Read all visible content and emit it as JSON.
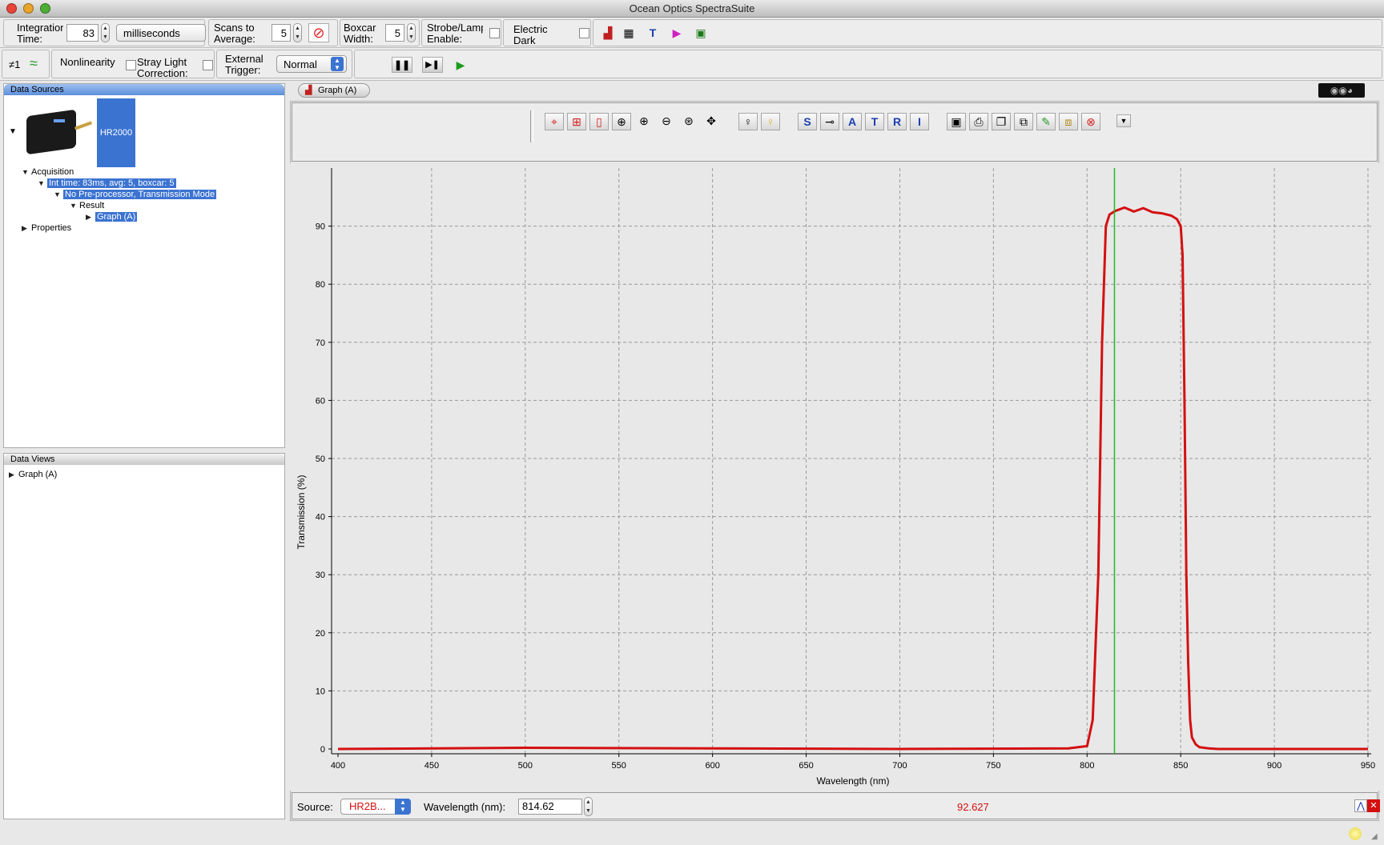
{
  "window": {
    "title": "Ocean Optics SpectraSuite"
  },
  "acq": {
    "integration_label": "Integration Time:",
    "integration_value": "83",
    "unit": "milliseconds",
    "scans_label": "Scans to Average:",
    "scans_value": "5",
    "boxcar_label": "Boxcar Width:",
    "boxcar_value": "5",
    "strobe_label": "Strobe/Lamp Enable:",
    "electric_dark_label": "Electric Dark"
  },
  "row2": {
    "nonlinearity_label": "Nonlinearity",
    "stray_light_label": "Stray Light Correction:",
    "ext_trigger_label": "External Trigger:",
    "trigger_mode": "Normal",
    "marker_label": "≠1"
  },
  "left": {
    "data_sources_title": "Data Sources",
    "device_name": "HR2000",
    "acquisition": "Acquisition",
    "params": "Int time: 83ms, avg: 5, boxcar: 5",
    "processor": "No Pre-processor, Transmission Mode",
    "result": "Result",
    "graph_node": "Graph (A)",
    "properties": "Properties",
    "data_views_title": "Data Views",
    "view_node": "Graph (A)"
  },
  "graph_tab": {
    "label": "Graph (A)"
  },
  "plot_toolbar": {
    "letters": [
      "S",
      "A",
      "T",
      "R",
      "I"
    ]
  },
  "chart_data": {
    "type": "line",
    "xlabel": "Wavelength (nm)",
    "ylabel": "Transmission (%)",
    "xlim": [
      400,
      950
    ],
    "ylim": [
      0,
      100
    ],
    "xticks": [
      400,
      450,
      500,
      550,
      600,
      650,
      700,
      750,
      800,
      850,
      900,
      950
    ],
    "yticks": [
      0,
      10,
      20,
      30,
      40,
      50,
      60,
      70,
      80,
      90
    ],
    "grid": true,
    "cursor_x": 814.62,
    "series": [
      {
        "color": "#d41010",
        "x": [
          400,
          500,
          600,
          700,
          790,
          800,
          803,
          806,
          808,
          810,
          812,
          815,
          820,
          825,
          830,
          835,
          840,
          845,
          848,
          850,
          851,
          852,
          853,
          854,
          855,
          856,
          858,
          860,
          865,
          870,
          900,
          950
        ],
        "y": [
          0,
          0.2,
          0.1,
          0,
          0.1,
          0.5,
          5,
          30,
          70,
          90,
          92,
          92.6,
          93.2,
          92.5,
          93.1,
          92.4,
          92.2,
          91.8,
          91.2,
          90,
          85,
          60,
          30,
          15,
          5,
          2,
          0.8,
          0.3,
          0.1,
          0,
          0,
          0
        ]
      }
    ]
  },
  "status": {
    "source_label": "Source:",
    "source_value": "HR2B...",
    "wavelength_label": "Wavelength (nm):",
    "wavelength_value": "814.62",
    "readout": "92.627"
  },
  "colors": {
    "accent": "#3b73d1",
    "series": "#d41010",
    "cursor": "#22bb22"
  }
}
